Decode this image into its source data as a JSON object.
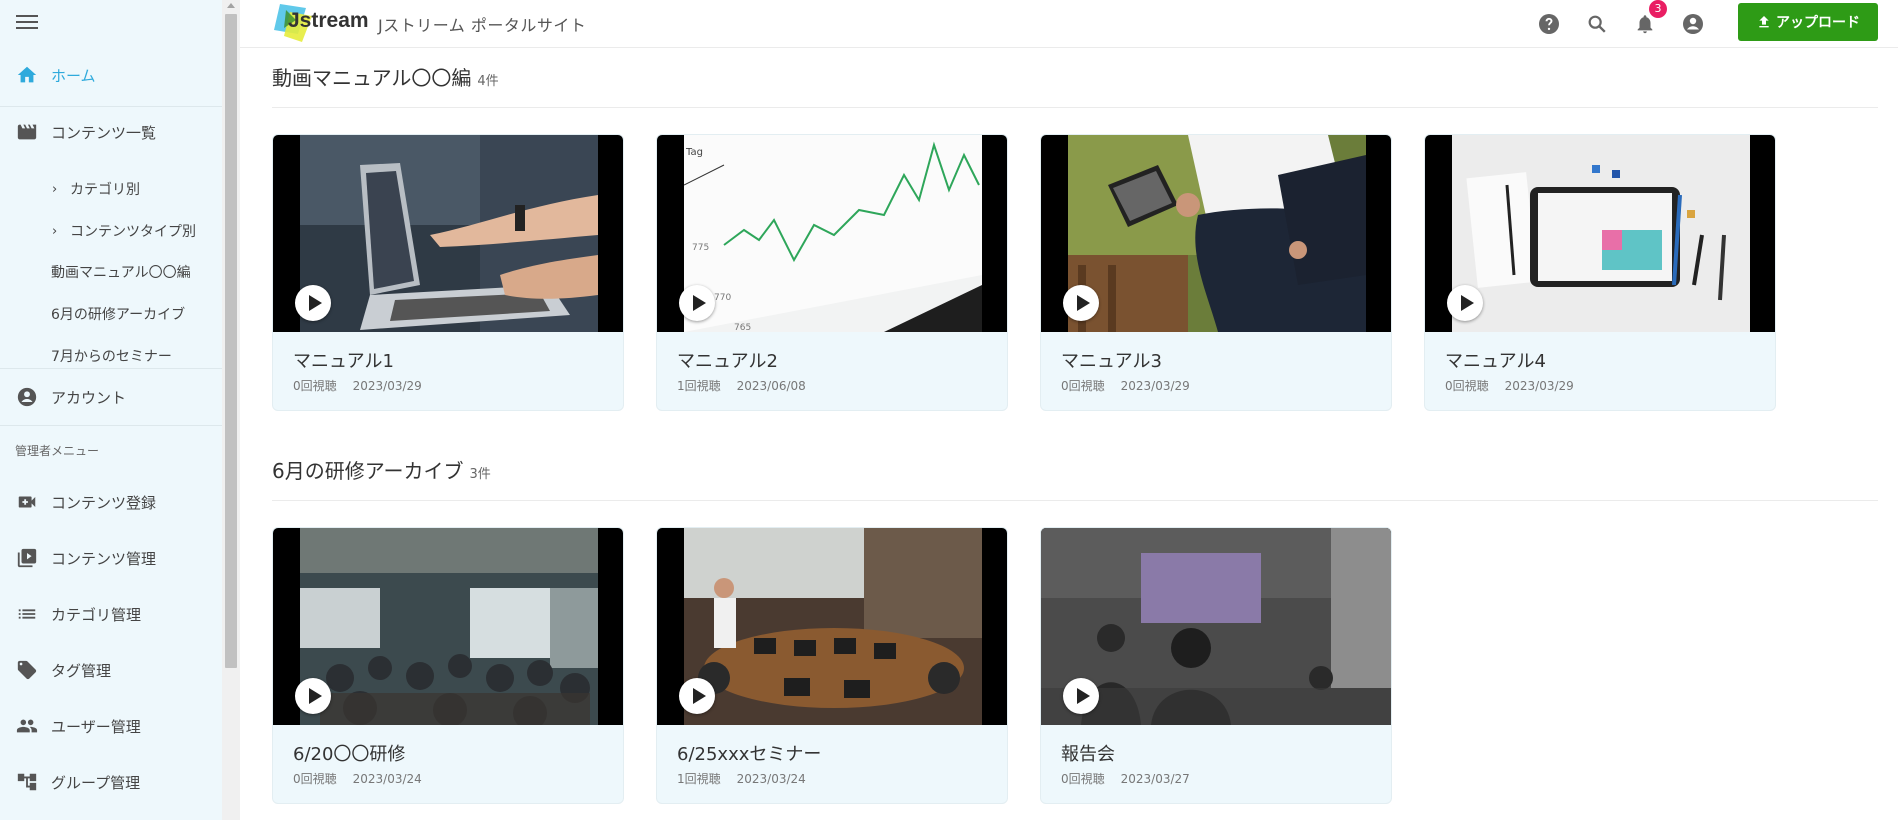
{
  "brand": {
    "logo_text": "Jstream",
    "site_title": "Jストリーム ポータルサイト"
  },
  "topbar": {
    "help_icon": "help-circle-icon",
    "search_icon": "search-icon",
    "notification_icon": "bell-icon",
    "notification_count": "3",
    "account_icon": "account-circle-icon",
    "upload_label": "アップロード"
  },
  "sidebar": {
    "menu_icon": "hamburger-icon",
    "items": [
      {
        "label": "ホーム",
        "icon": "home-icon"
      },
      {
        "label": "コンテンツ一覧",
        "icon": "movie-icon"
      },
      {
        "label": "カテゴリ別"
      },
      {
        "label": "コンテンツタイプ別"
      },
      {
        "label": "動画マニュアル〇〇編"
      },
      {
        "label": "6月の研修アーカイブ"
      },
      {
        "label": "7月からのセミナー"
      },
      {
        "label": "アカウント",
        "icon": "account-circle-icon"
      }
    ],
    "admin_label": "管理者メニュー",
    "admin_items": [
      {
        "label": "コンテンツ登録",
        "icon": "video-plus-icon"
      },
      {
        "label": "コンテンツ管理",
        "icon": "video-library-icon"
      },
      {
        "label": "カテゴリ管理",
        "icon": "list-icon"
      },
      {
        "label": "タグ管理",
        "icon": "tag-icon"
      },
      {
        "label": "ユーザー管理",
        "icon": "people-icon"
      },
      {
        "label": "グループ管理",
        "icon": "hierarchy-icon"
      }
    ]
  },
  "sections": [
    {
      "title": "動画マニュアル〇〇編",
      "count": "4件",
      "cards": [
        {
          "title": "マニュアル1",
          "views": "0回視聴",
          "date": "2023/03/29"
        },
        {
          "title": "マニュアル2",
          "views": "1回視聴",
          "date": "2023/06/08"
        },
        {
          "title": "マニュアル3",
          "views": "0回視聴",
          "date": "2023/03/29"
        },
        {
          "title": "マニュアル4",
          "views": "0回視聴",
          "date": "2023/03/29"
        }
      ]
    },
    {
      "title": "6月の研修アーカイブ",
      "count": "3件",
      "cards": [
        {
          "title": "6/20〇〇研修",
          "views": "0回視聴",
          "date": "2023/03/24"
        },
        {
          "title": "6/25xxxセミナー",
          "views": "1回視聴",
          "date": "2023/03/24"
        },
        {
          "title": "報告会",
          "views": "0回視聴",
          "date": "2023/03/27"
        }
      ]
    }
  ],
  "colors": {
    "accent": "#2eaadc",
    "sidebar_bg": "#eef8fc",
    "upload_button": "#2e9b16",
    "badge": "#e91e63"
  }
}
